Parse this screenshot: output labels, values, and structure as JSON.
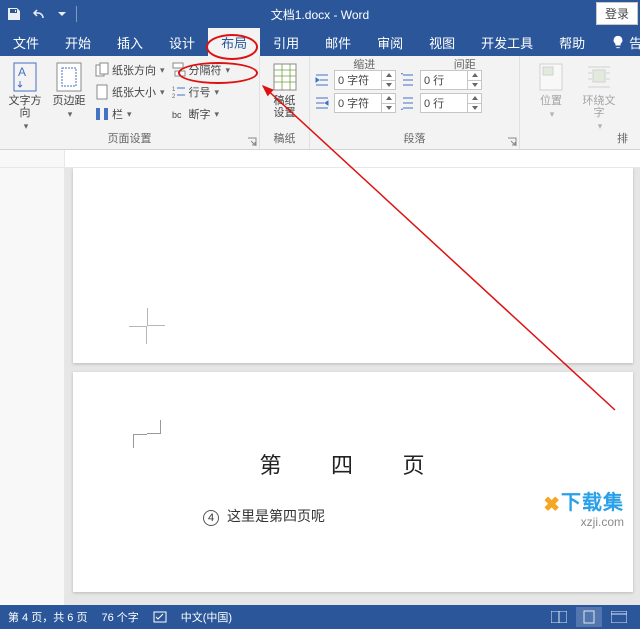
{
  "titlebar": {
    "doc_title": "文档1.docx - Word",
    "login": "登录"
  },
  "tabs": {
    "file": "文件",
    "home": "开始",
    "insert": "插入",
    "design": "设计",
    "layout": "布局",
    "references": "引用",
    "mailings": "邮件",
    "review": "审阅",
    "view": "视图",
    "devtools": "开发工具",
    "help": "帮助",
    "tell": "告"
  },
  "ribbon": {
    "page_setup_group": "页面设置",
    "text_direction": "文字方向",
    "margins": "页边距",
    "orientation": "纸张方向",
    "size": "纸张大小",
    "columns": "栏",
    "breaks": "分隔符",
    "line_numbers": "行号",
    "hyphenation": "断字",
    "manuscript_group": "稿纸",
    "manuscript": "稿纸\n设置",
    "paragraph_group": "段落",
    "indent_label": "缩进",
    "spacing_label": "间距",
    "indent_left": "0 字符",
    "indent_right": "0 字符",
    "spacing_before": "0 行",
    "spacing_after": "0 行",
    "arrange_group_truncated": "排",
    "position": "位置",
    "wrap_text": "环绕文字"
  },
  "doc": {
    "page4_title": "第 四 页",
    "page4_num": "4",
    "page4_body": "这里是第四页呢"
  },
  "status": {
    "page": "第 4 页，共 6 页",
    "words": "76 个字",
    "lang": "中文(中国)"
  },
  "watermark": {
    "brand": "下载集",
    "url": "xzji.com"
  }
}
